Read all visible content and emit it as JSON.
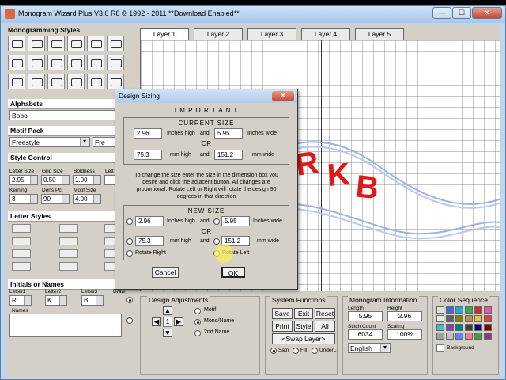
{
  "window": {
    "title": "Monogram Wizard Plus V3.0 R8 © 1992 - 2011  **Download Enabled**",
    "min": "—",
    "max": "☐",
    "close": "✕"
  },
  "left": {
    "monogramming_styles": "Monogramming Styles",
    "alphabets": "Alphabets",
    "alphabet_value": "Bobo",
    "motif_pack": "Motif Pack",
    "motif_value": "Freestyle",
    "motif_extra": "Fre",
    "style_control": "Style Control",
    "labels": {
      "letter_size": "Letter Size",
      "grid_size": "Grid Size",
      "boldness": "Boldness",
      "letter": "Lett",
      "kerning": "Kerning",
      "dens_pct": "Dens Pct",
      "motif_size": "Motif Size"
    },
    "values": {
      "letter_size": "2.95",
      "grid_size": "0.50",
      "boldness": "1.00",
      "kerning": "3",
      "dens_pct": "90",
      "motif_size": "4.00"
    },
    "letter_styles": "Letter Styles",
    "initials": "Initials or Names",
    "letter1": "Letter1",
    "letter2": "Letter2",
    "letter3": "Letter3",
    "draw": "Draw",
    "l1": "R",
    "l2": "K",
    "l3": "B",
    "names": "Names"
  },
  "tabs": [
    "Layer 1",
    "Layer 2",
    "Layer 3",
    "Layer 4",
    "Layer 5"
  ],
  "monogram": {
    "r": "R",
    "k": "K",
    "b": "B"
  },
  "dialog": {
    "title": "Design Sizing",
    "close": "✕",
    "important": "I M P O R T A N T",
    "current_size": "CURRENT SIZE",
    "cur_h_in": "2.96",
    "cur_w_in": "5.95",
    "cur_h_mm": "75.3",
    "cur_w_mm": "151.2",
    "inches_high": "Inches high",
    "inches_wide": "Inches wide",
    "and": "and",
    "or": "OR",
    "mm_high": "mm high",
    "mm_wide": "mm wide",
    "instructions": "To change the size enter the size in the dimension box you desire and click the adjacent button.  All changes are proportional.  Rotate Left or Right will rotate the design 90 degrees in that direction",
    "new_size": "NEW SIZE",
    "new_h_in": "2.96",
    "new_w_in": "5.95",
    "new_h_mm": "75.3",
    "new_w_mm": "151.2",
    "rotate_right": "Rotate Right",
    "rotate_left": "Rotate Left",
    "cancel": "Cancel",
    "ok": "OK"
  },
  "bottom": {
    "design_adjustments": "Design Adjustments",
    "motif": "Motif",
    "mono_name": "Mono/Name",
    "second_name": "2nd Name",
    "step": "1",
    "system_functions": "System Functions",
    "save": "Save",
    "exit": "Exit",
    "reset": "Reset",
    "print": "Print",
    "style": "Style",
    "all": "All",
    "swap_layer": "Swap Layer",
    "satn": "Satn",
    "fill": "Fill",
    "underl": "UnderL",
    "monogram_info": "Monogram Information",
    "length_lbl": "Length",
    "height_lbl": "Height",
    "length": "5.95",
    "height": "2.96",
    "stitch_lbl": "Stitch Count",
    "scaling_lbl": "Scaling",
    "stitch": "6034",
    "scaling": "100%",
    "language": "English",
    "color_sequence": "Color Sequence",
    "background": "Background"
  },
  "colors": [
    "#e0e0e0",
    "#3a6fd8",
    "#2aa4d4",
    "#2bb24c",
    "#d42a2a",
    "#e05ab0",
    "#e8e8e8",
    "#606060",
    "#808000",
    "#c09050",
    "#f0c040",
    "#e04040",
    "#40c0c0",
    "#8040c0",
    "#008080",
    "#404040",
    "#000080",
    "#800000",
    "#a0a0a0",
    "#c0c0c0",
    "#6080ff",
    "#f08080",
    "#40a040",
    "#804080"
  ]
}
